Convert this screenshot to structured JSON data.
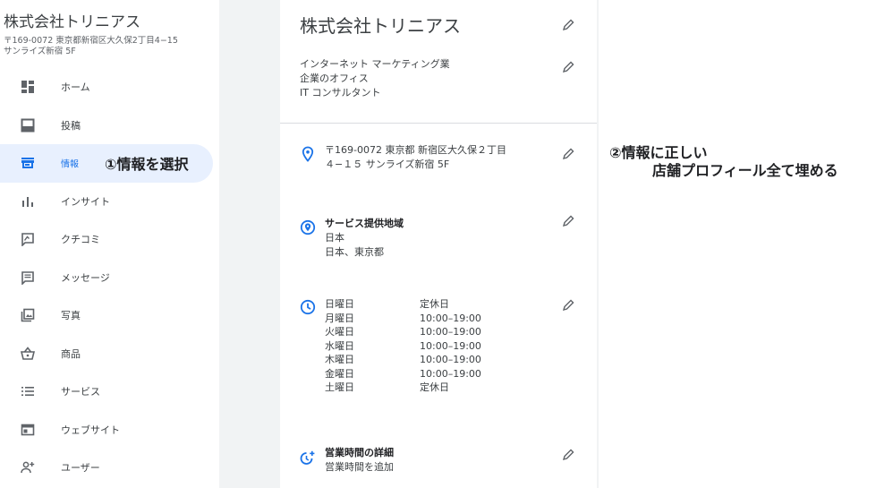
{
  "sidebar": {
    "business_name": "株式会社トリニアス",
    "address_line1": "〒169-0072 東京都新宿区大久保2丁目4−15",
    "address_line2": "サンライズ新宿 5F",
    "items": [
      {
        "label": "ホーム",
        "icon": "dashboard-icon"
      },
      {
        "label": "投稿",
        "icon": "post-icon"
      },
      {
        "label": "情報",
        "icon": "storefront-icon"
      },
      {
        "label": "インサイト",
        "icon": "insights-icon"
      },
      {
        "label": "クチコミ",
        "icon": "review-icon"
      },
      {
        "label": "メッセージ",
        "icon": "message-icon"
      },
      {
        "label": "写真",
        "icon": "photo-icon"
      },
      {
        "label": "商品",
        "icon": "basket-icon"
      },
      {
        "label": "サービス",
        "icon": "list-icon"
      },
      {
        "label": "ウェブサイト",
        "icon": "website-icon"
      },
      {
        "label": "ユーザー",
        "icon": "add-user-icon"
      }
    ],
    "active_index": 2
  },
  "annotations": {
    "select_info": "①情報を選択",
    "fill_line1": "②情報に正しい",
    "fill_line2": "店舗プロフィール全て埋める"
  },
  "info": {
    "title": "株式会社トリニアス",
    "categories": [
      "インターネット マーケティング業",
      "企業のオフィス",
      "IT コンサルタント"
    ],
    "address_line1": "〒169-0072 東京都 新宿区大久保２丁目",
    "address_line2": "４−１５ サンライズ新宿 5F",
    "service_area": {
      "heading": "サービス提供地域",
      "lines": [
        "日本",
        "日本、東京都"
      ]
    },
    "hours": [
      {
        "day": "日曜日",
        "time": "定休日"
      },
      {
        "day": "月曜日",
        "time": "10:00–19:00"
      },
      {
        "day": "火曜日",
        "time": "10:00–19:00"
      },
      {
        "day": "水曜日",
        "time": "10:00–19:00"
      },
      {
        "day": "木曜日",
        "time": "10:00–19:00"
      },
      {
        "day": "金曜日",
        "time": "10:00–19:00"
      },
      {
        "day": "土曜日",
        "time": "定休日"
      }
    ],
    "more_hours": {
      "heading": "営業時間の詳細",
      "sub": "営業時間を追加"
    }
  },
  "colors": {
    "accent": "#1a73e8",
    "active_bg": "#e8f0fe",
    "icon": "#5f6368",
    "gap": "#f1f3f4"
  }
}
